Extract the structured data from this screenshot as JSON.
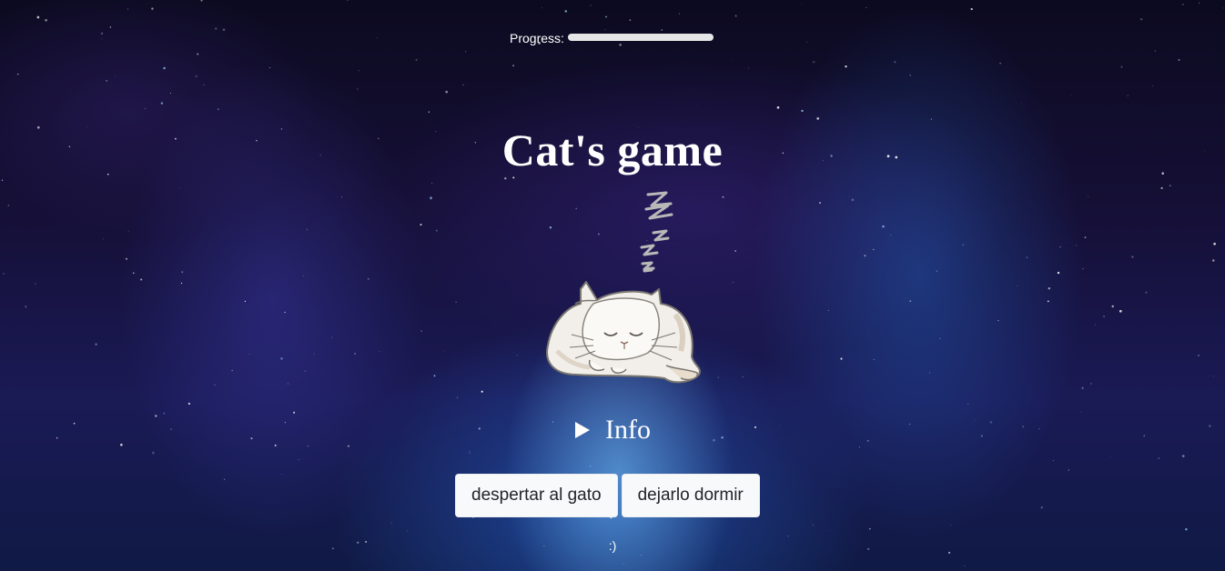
{
  "progress": {
    "label": "Progress:",
    "value_percent": 0
  },
  "title": "Cat's game",
  "illustration": {
    "name": "sleeping-cat",
    "caption": ""
  },
  "info": {
    "label": "Info",
    "state": "collapsed"
  },
  "actions": {
    "wake_label": "despertar al gato",
    "sleep_label": "dejarlo dormir"
  },
  "footer": {
    "smiley": ":)"
  },
  "colors": {
    "background_deep": "#0c0a20",
    "nebula_blue": "#3b8ee0",
    "button_bg": "#f8f9fa",
    "button_text": "#212529",
    "text": "#ffffff"
  }
}
